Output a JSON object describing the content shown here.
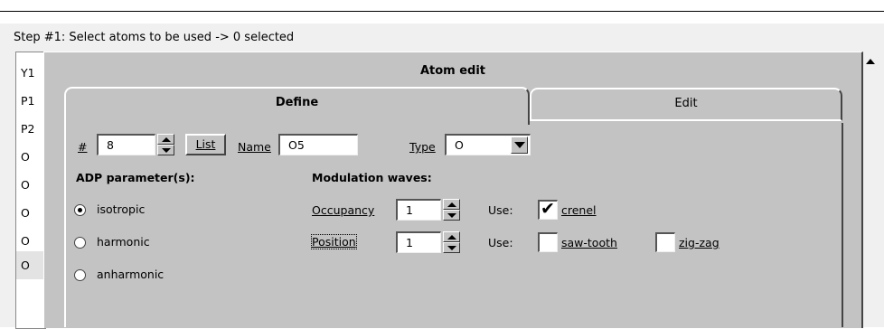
{
  "background": {
    "step_text": "Step #1: Select atoms to be used  -> 0 selected",
    "atoms": [
      "Y1",
      "P1",
      "P2",
      "O",
      "O",
      "O",
      "O",
      "O"
    ]
  },
  "dialog": {
    "title": "Atom edit",
    "tabs": [
      {
        "label": "Define",
        "active": true
      },
      {
        "label": "Edit",
        "active": false
      }
    ],
    "number": {
      "label": "#",
      "value": "8"
    },
    "list_button": "List",
    "name": {
      "label": "Name",
      "value": "O5"
    },
    "type": {
      "label": "Type",
      "value": "O"
    },
    "adp": {
      "heading": "ADP parameter(s):",
      "options": [
        {
          "label": "isotropic",
          "selected": true
        },
        {
          "label": "harmonic",
          "selected": false
        },
        {
          "label": "anharmonic",
          "selected": false
        }
      ]
    },
    "modulation": {
      "heading": "Modulation waves:",
      "occupancy": {
        "label": "Occupancy",
        "value": "1",
        "use_label": "Use:",
        "checks": [
          {
            "label": "crenel",
            "checked": true
          }
        ]
      },
      "position": {
        "label": "Position",
        "value": "1",
        "use_label": "Use:",
        "checks": [
          {
            "label": "saw-tooth",
            "checked": false
          },
          {
            "label": "zig-zag",
            "checked": false
          }
        ]
      }
    }
  },
  "colors": {
    "dialog_bg": "#c3c3c3",
    "window_bg": "#f0f0f0"
  }
}
